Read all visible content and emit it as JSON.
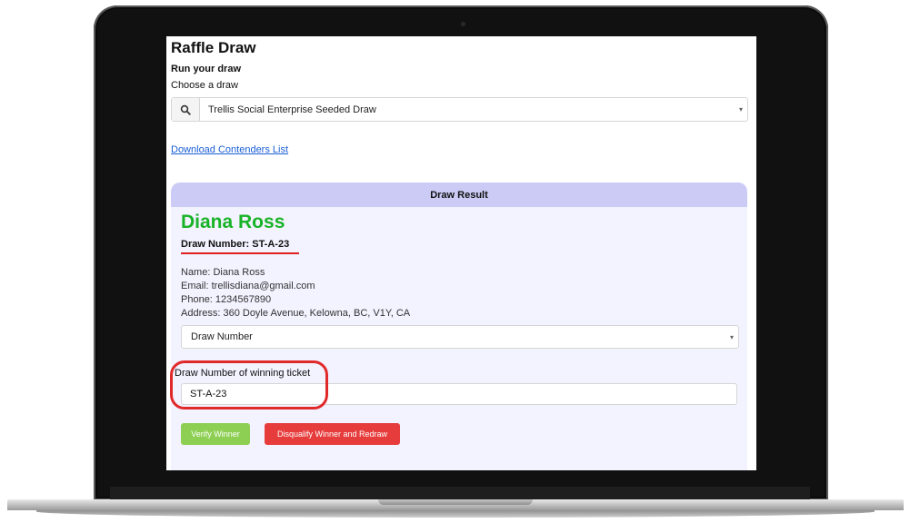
{
  "app": {
    "title": "Raffle Draw",
    "section_title": "Run your draw",
    "choose_label": "Choose a draw"
  },
  "draw_select": {
    "icon": "search-icon",
    "selected": "Trellis Social Enterprise Seeded Draw"
  },
  "download_link": "Download Contenders List",
  "result": {
    "header": "Draw Result",
    "winner_name": "Diana Ross",
    "draw_number": "Draw Number: ST-A-23",
    "details": [
      "Name: Diana Ross",
      "Email: trellisdiana@gmail.com",
      "Phone: 1234567890",
      "Address: 360 Doyle Avenue, Kelowna, BC, V1Y, CA"
    ],
    "field_select": "Draw Number",
    "ticket_label": "Draw Number of winning ticket",
    "ticket_value": "ST-A-23",
    "verify_label": "Verify Winner",
    "disqualify_label": "Disqualify Winner and Redraw"
  },
  "colors": {
    "winner_green": "#19b327",
    "annotation_red": "#e02020",
    "card_header": "#cbcbf6",
    "card_body": "#f3f2ff",
    "link_blue": "#1a5fd6",
    "verify_green": "#8ccf52",
    "disqualify_red": "#e73c3c"
  }
}
